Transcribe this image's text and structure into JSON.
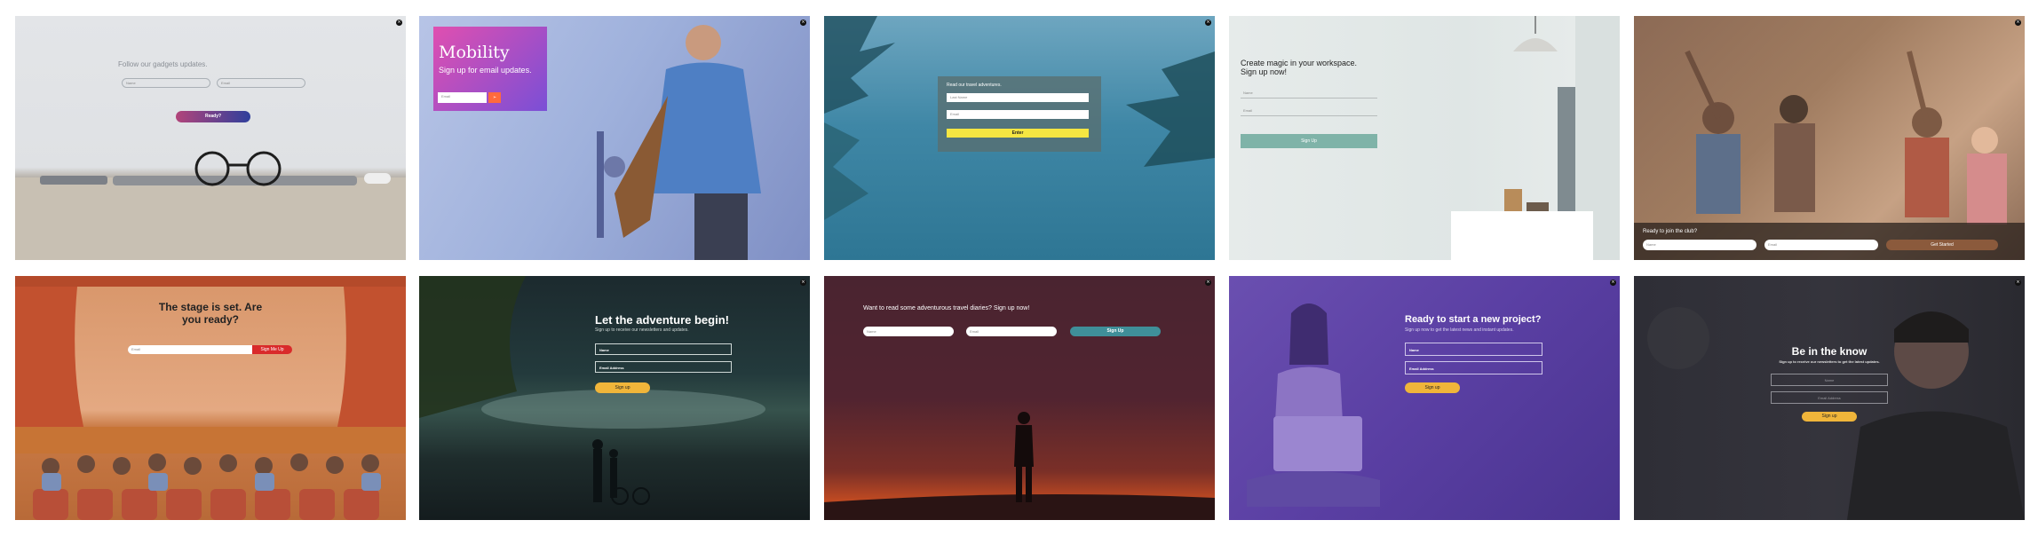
{
  "close_glyph": "×",
  "cards": {
    "gadgets": {
      "heading": "Follow our gadgets updates.",
      "name_placeholder": "Name",
      "email_placeholder": "Email",
      "button": "Ready?"
    },
    "mobility": {
      "title": "Mobility",
      "subtitle": "Sign up for email updates.",
      "email_placeholder": "Email",
      "arrow": "➢"
    },
    "travel_form": {
      "heading": "Read our travel adventures.",
      "name_placeholder": "Last Name",
      "email_placeholder": "Email",
      "button": "Enter"
    },
    "workspace": {
      "heading_line1": "Create magic in your workspace.",
      "heading_line2": "Sign up now!",
      "name_label": "Name",
      "email_label": "Email",
      "button": "Sign Up"
    },
    "club": {
      "heading": "Ready to join the club?",
      "name_placeholder": "Name",
      "email_placeholder": "Email",
      "button": "Get Started"
    },
    "stage": {
      "heading_line1": "The stage is set. Are",
      "heading_line2": "you ready?",
      "email_placeholder": "Email",
      "button": "Sign Me Up"
    },
    "adventure": {
      "heading": "Let the adventure begin!",
      "subheading": "Sign up to receive our newsletters and updates.",
      "name_label": "Name",
      "email_label": "Email Address",
      "button": "Sign up"
    },
    "diaries": {
      "heading": "Want to read some adventurous travel diaries? Sign up now!",
      "name_placeholder": "Name",
      "email_placeholder": "Email",
      "button": "Sign Up"
    },
    "project": {
      "heading": "Ready to start a new project?",
      "subheading": "Sign up now to get the latest news and instant updates.",
      "name_label": "Name",
      "email_label": "Email Address",
      "button": "Sign up"
    },
    "know": {
      "heading": "Be in the know",
      "subheading": "Sign up to receive our newsletters to get the latest updates.",
      "name_placeholder": "Name",
      "email_placeholder": "Email Address",
      "button": "Sign up"
    }
  },
  "colors": {
    "teal_button": "#7fb3a8",
    "yellow_button": "#f5e642",
    "gold_button": "#f0b53a",
    "red_button": "#d92b2b",
    "teal_dark_button": "#3f8f99",
    "mobility_gradient_start": "#e04fb0",
    "mobility_gradient_end": "#7a4fd6"
  }
}
